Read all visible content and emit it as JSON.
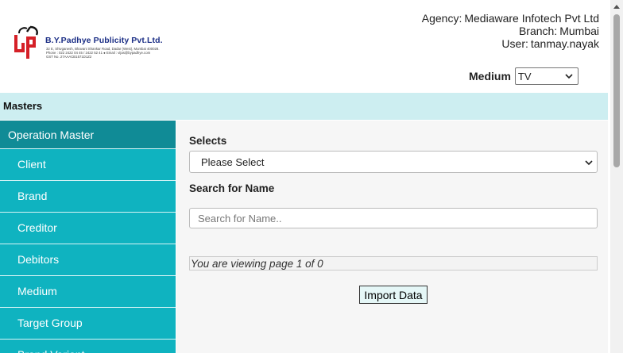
{
  "header": {
    "logo": {
      "name": "B.Y.Padhye Publicity Pvt.Ltd.",
      "line1": "32 E, Shivganesh, Bhavani Shankar Road, Dadar (West), Mumbai 400028.",
      "line2": "Phone : 022 2422 04 45 / 2422 52 41 ● Email : vijas@bypadhye.com",
      "line3": "GST No. 27AAACB1571D1Z2"
    },
    "agency": {
      "label": "Agency:",
      "value": "Mediaware Infotech Pvt Ltd"
    },
    "branch": {
      "label": "Branch:",
      "value": "Mumbai"
    },
    "user": {
      "label": "User:",
      "value": "tanmay.nayak"
    },
    "medium": {
      "label": "Medium",
      "selected": "TV"
    }
  },
  "masters_bar": {
    "title": "Masters"
  },
  "sidebar": {
    "head": "Operation Master",
    "items": [
      {
        "label": "Client"
      },
      {
        "label": "Brand"
      },
      {
        "label": "Creditor"
      },
      {
        "label": "Debitors"
      },
      {
        "label": "Medium"
      },
      {
        "label": "Target Group"
      },
      {
        "label": "Brand Variant"
      }
    ]
  },
  "main": {
    "selects_label": "Selects",
    "selects_value": "Please Select",
    "search_label": "Search for Name",
    "search_placeholder": "Search for Name..",
    "search_value": "",
    "page_info": "You are viewing page 1 of 0",
    "import_button": "Import Data"
  },
  "colors": {
    "sidebar_bg": "#0fb3c0",
    "sidebar_head_bg": "#108b96",
    "masters_bar_bg": "#cdeef1",
    "logo_red": "#d52027",
    "logo_blue": "#1c2f86"
  }
}
